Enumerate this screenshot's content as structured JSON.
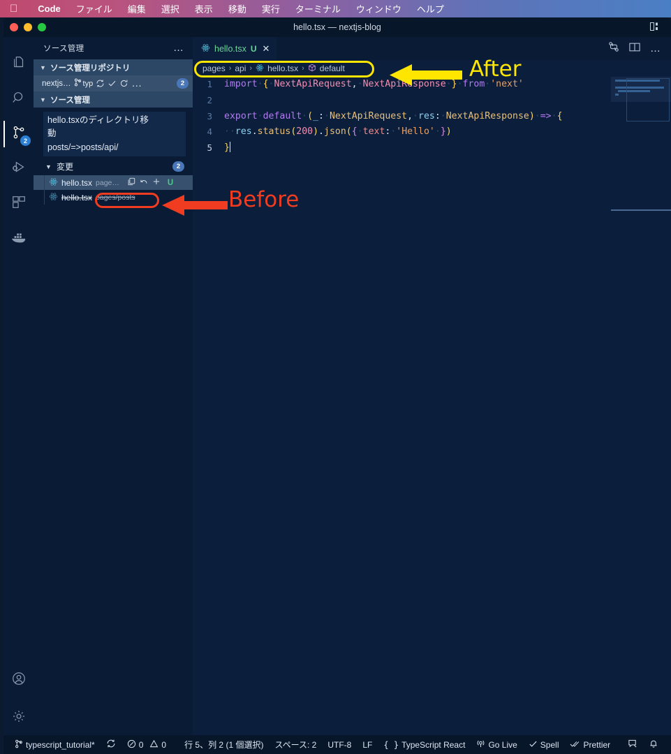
{
  "menubar": {
    "apple_icon": "apple-icon",
    "items": [
      {
        "label": "Code",
        "bold": true
      },
      {
        "label": "ファイル",
        "bold": false
      },
      {
        "label": "編集",
        "bold": false
      },
      {
        "label": "選択",
        "bold": false
      },
      {
        "label": "表示",
        "bold": false
      },
      {
        "label": "移動",
        "bold": false
      },
      {
        "label": "実行",
        "bold": false
      },
      {
        "label": "ターミナル",
        "bold": false
      },
      {
        "label": "ウィンドウ",
        "bold": false
      },
      {
        "label": "ヘルプ",
        "bold": false
      }
    ]
  },
  "window": {
    "title": "hello.tsx — nextjs-blog"
  },
  "activitybar": {
    "items": [
      {
        "name": "explorer",
        "icon": "files-icon",
        "badge": ""
      },
      {
        "name": "search",
        "icon": "search-icon",
        "badge": ""
      },
      {
        "name": "source-control",
        "icon": "source-control-icon",
        "badge": "2"
      },
      {
        "name": "run-debug",
        "icon": "run-debug-icon",
        "badge": ""
      },
      {
        "name": "extensions",
        "icon": "extensions-icon",
        "badge": ""
      },
      {
        "name": "docker",
        "icon": "docker-whale-icon",
        "badge": ""
      }
    ],
    "bottom": [
      {
        "name": "account",
        "icon": "account-icon"
      },
      {
        "name": "settings",
        "icon": "gear-icon"
      }
    ]
  },
  "sidebar": {
    "header_title": "ソース管理",
    "header_more": "…",
    "repositories_section": "ソース管理リポジトリ",
    "repo": {
      "name": "nextjs…",
      "branch": "typ",
      "badge": "2",
      "actions": [
        "sync-icon",
        "check-icon",
        "refresh-icon",
        "more-icon"
      ]
    },
    "source_control_section": "ソース管理",
    "commit_message": "hello.tsxのディレクトリ移動\nposts/=>posts/api/",
    "commit_message_lines": [
      "hello.tsxのディレクトリ移",
      "動",
      "posts/=>posts/api/"
    ],
    "changes_section": "変更",
    "changes_badge": "2",
    "files": [
      {
        "icon": "react-file-icon",
        "name": "hello.tsx",
        "path": "page…",
        "status": "U",
        "actions": [
          "open-file-icon",
          "discard-changes-icon",
          "stage-changes-icon"
        ],
        "selected": true,
        "struck": false
      },
      {
        "icon": "react-file-icon",
        "name": "hello.tsx",
        "path": "pages/posts",
        "status": "",
        "actions": [],
        "selected": false,
        "struck": true
      }
    ]
  },
  "editor": {
    "tab": {
      "icon": "react-file-icon",
      "label": "hello.tsx",
      "status": "U",
      "close": "✕"
    },
    "tab_actions": [
      "compare-changes-icon",
      "split-editor-icon",
      "more-actions-icon"
    ],
    "breadcrumbs": [
      {
        "label": "pages",
        "icon": ""
      },
      {
        "label": "api",
        "icon": ""
      },
      {
        "label": "hello.tsx",
        "icon": "react-file-icon"
      },
      {
        "label": "default",
        "icon": "symbol-cube-icon"
      }
    ],
    "breadcrumb_separator": "›",
    "line_numbers": [
      "1",
      "2",
      "3",
      "4",
      "5"
    ],
    "code_lines": [
      "import { NextApiRequest, NextApiResponse } from 'next'",
      "",
      "export default (_: NextApiRequest, res: NextApiResponse) => {",
      "  res.status(200).json({ text: 'Hello' })",
      "}"
    ]
  },
  "statusbar": {
    "left": [
      {
        "name": "branch",
        "icon": "branch-icon",
        "label": "typescript_tutorial*"
      },
      {
        "name": "sync",
        "icon": "sync-icon",
        "label": ""
      },
      {
        "name": "problems",
        "icon": "error-warning-icon",
        "label": "0  0"
      },
      {
        "name": "cursor-position",
        "icon": "",
        "label": "行 5、列 2 (1 個選択)"
      },
      {
        "name": "indentation",
        "icon": "",
        "label": "スペース: 2"
      },
      {
        "name": "encoding",
        "icon": "",
        "label": "UTF-8"
      },
      {
        "name": "eol",
        "icon": "",
        "label": "LF"
      },
      {
        "name": "language-mode",
        "icon": "braces-icon",
        "label": "TypeScript React"
      },
      {
        "name": "go-live",
        "icon": "broadcast-icon",
        "label": "Go Live"
      },
      {
        "name": "spell",
        "icon": "check-icon",
        "label": "Spell"
      },
      {
        "name": "prettier",
        "icon": "checks-icon",
        "label": "Prettier"
      },
      {
        "name": "feedback",
        "icon": "feedback-icon",
        "label": ""
      },
      {
        "name": "notifications",
        "icon": "bell-icon",
        "label": ""
      }
    ],
    "problems_errors": "0",
    "problems_warnings": "0"
  },
  "annotations": {
    "after_label": "After",
    "after_color": "#ffe600",
    "before_label": "Before",
    "before_color": "#f03c20"
  }
}
